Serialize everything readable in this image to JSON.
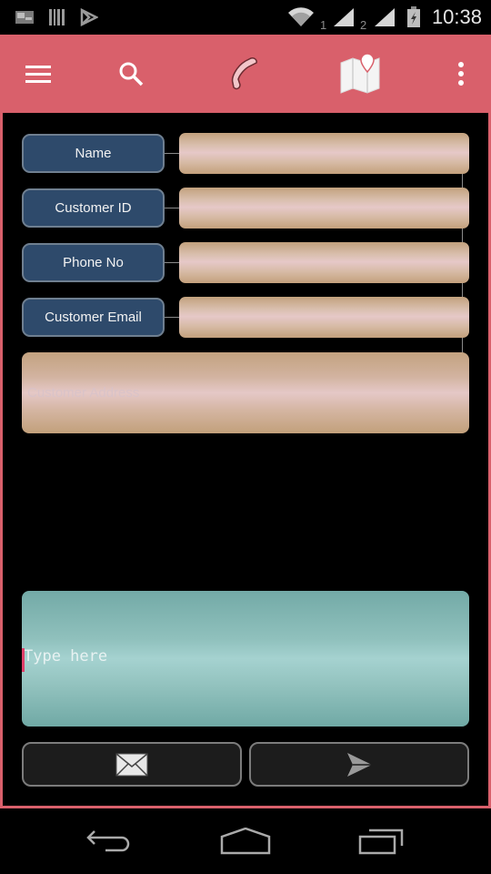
{
  "status_bar": {
    "icons": [
      "gallery-notification-icon",
      "barcode-notification-icon",
      "play-store-notification-icon",
      "wifi-icon",
      "signal-icon",
      "signal-icon",
      "battery-charging-icon"
    ],
    "sim1_label": "1",
    "sim2_label": "2",
    "time": "10:38"
  },
  "app_bar": {
    "actions": [
      "menu",
      "search",
      "call",
      "map",
      "overflow"
    ],
    "accent_color": "#d9606b"
  },
  "form": {
    "fields": [
      {
        "label": "Name",
        "value": "",
        "placeholder": ""
      },
      {
        "label": "Customer ID",
        "value": "",
        "placeholder": ""
      },
      {
        "label": "Phone No",
        "value": "",
        "placeholder": ""
      },
      {
        "label": "Customer Email",
        "value": "",
        "placeholder": ""
      }
    ],
    "address": {
      "value": "",
      "placeholder": "Customer Address"
    }
  },
  "message": {
    "value": "",
    "placeholder": "Type here"
  },
  "actions": {
    "email_icon": "envelope-icon",
    "send_icon": "send-icon"
  },
  "nav_bar": {
    "buttons": [
      "back",
      "home",
      "recents"
    ]
  }
}
